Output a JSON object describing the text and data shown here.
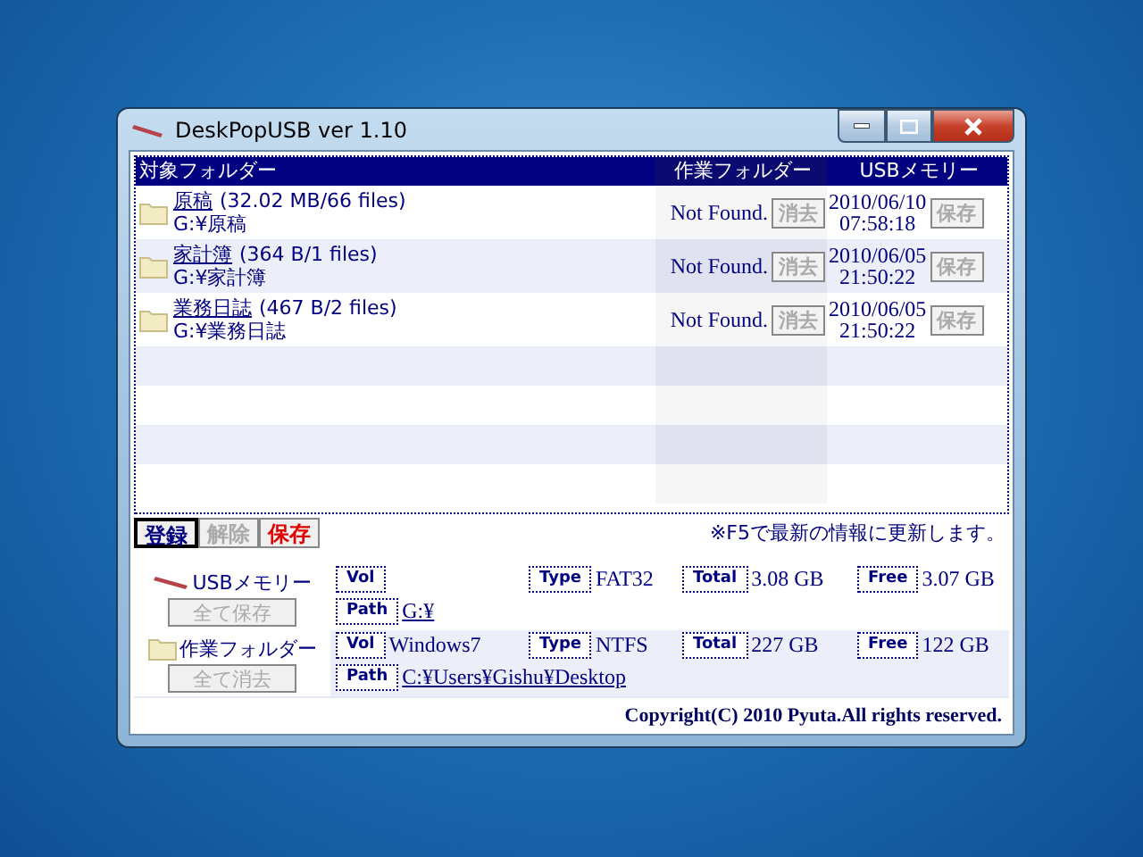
{
  "window": {
    "title": "DeskPopUSB ver 1.10"
  },
  "table": {
    "columns": [
      "対象フォルダー",
      "作業フォルダー",
      "USBメモリー"
    ],
    "rows": [
      {
        "name": "原稿",
        "size": "(32.02 MB/66 files)",
        "path": "G:¥原稿",
        "work_status": "Not Found.",
        "work_button": {
          "label": "消去",
          "disabled": true
        },
        "usb_date": "2010/06/10",
        "usb_time": "07:58:18",
        "usb_button": {
          "label": "保存",
          "disabled": true
        }
      },
      {
        "name": "家計簿",
        "size": "(364 B/1 files)",
        "path": "G:¥家計簿",
        "work_status": "Not Found.",
        "work_button": {
          "label": "消去",
          "disabled": true
        },
        "usb_date": "2010/06/05",
        "usb_time": "21:50:22",
        "usb_button": {
          "label": "保存",
          "disabled": true
        }
      },
      {
        "name": "業務日誌",
        "size": "(467 B/2 files)",
        "path": "G:¥業務日誌",
        "work_status": "Not Found.",
        "work_button": {
          "label": "消去",
          "disabled": true
        },
        "usb_date": "2010/06/05",
        "usb_time": "21:50:22",
        "usb_button": {
          "label": "保存",
          "disabled": true
        }
      }
    ]
  },
  "actions": [
    {
      "label": "登録",
      "kind": "default"
    },
    {
      "label": "解除",
      "kind": "disabled"
    },
    {
      "label": "保存",
      "kind": "danger"
    }
  ],
  "hint": "※F5で最新の情報に更新します。",
  "drives": [
    {
      "kind": "usb",
      "name": "USBメモリー",
      "button": {
        "label": "全て保存",
        "disabled": true
      },
      "vol_label": "Vol",
      "type_label": "Type",
      "type": "FAT32",
      "total_label": "Total",
      "total": "3.08 GB",
      "free_label": "Free",
      "free": "3.07 GB",
      "path_label": "Path",
      "path": "G:¥"
    },
    {
      "kind": "folder",
      "name": "作業フォルダー",
      "button": {
        "label": "全て消去",
        "disabled": true
      },
      "vol_label": "Vol",
      "vol": "Windows7",
      "type_label": "Type",
      "type": "NTFS",
      "total_label": "Total",
      "total": "227 GB",
      "free_label": "Free",
      "free": "122 GB",
      "path_label": "Path",
      "path": "C:¥Users¥Gishu¥Desktop"
    }
  ],
  "copyright": "Copyright(C) 2010 Pyuta.All rights reserved."
}
